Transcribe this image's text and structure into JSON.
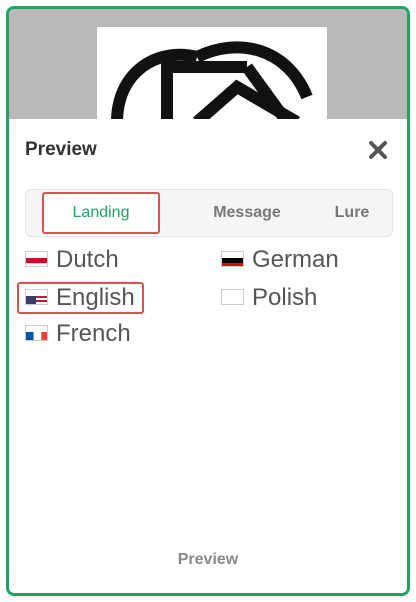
{
  "header": {
    "title": "Preview"
  },
  "icons": {
    "close": "close-icon"
  },
  "tabs": [
    {
      "label": "Landing",
      "active": true
    },
    {
      "label": "Message",
      "active": false
    },
    {
      "label": "Lure",
      "active": false
    }
  ],
  "languages": {
    "dutch": "Dutch",
    "german": "German",
    "english": "English",
    "polish": "Polish",
    "french": "French"
  },
  "footer": {
    "label": "Preview"
  },
  "colors": {
    "accent": "#1fa463",
    "highlight": "#d9534f"
  }
}
